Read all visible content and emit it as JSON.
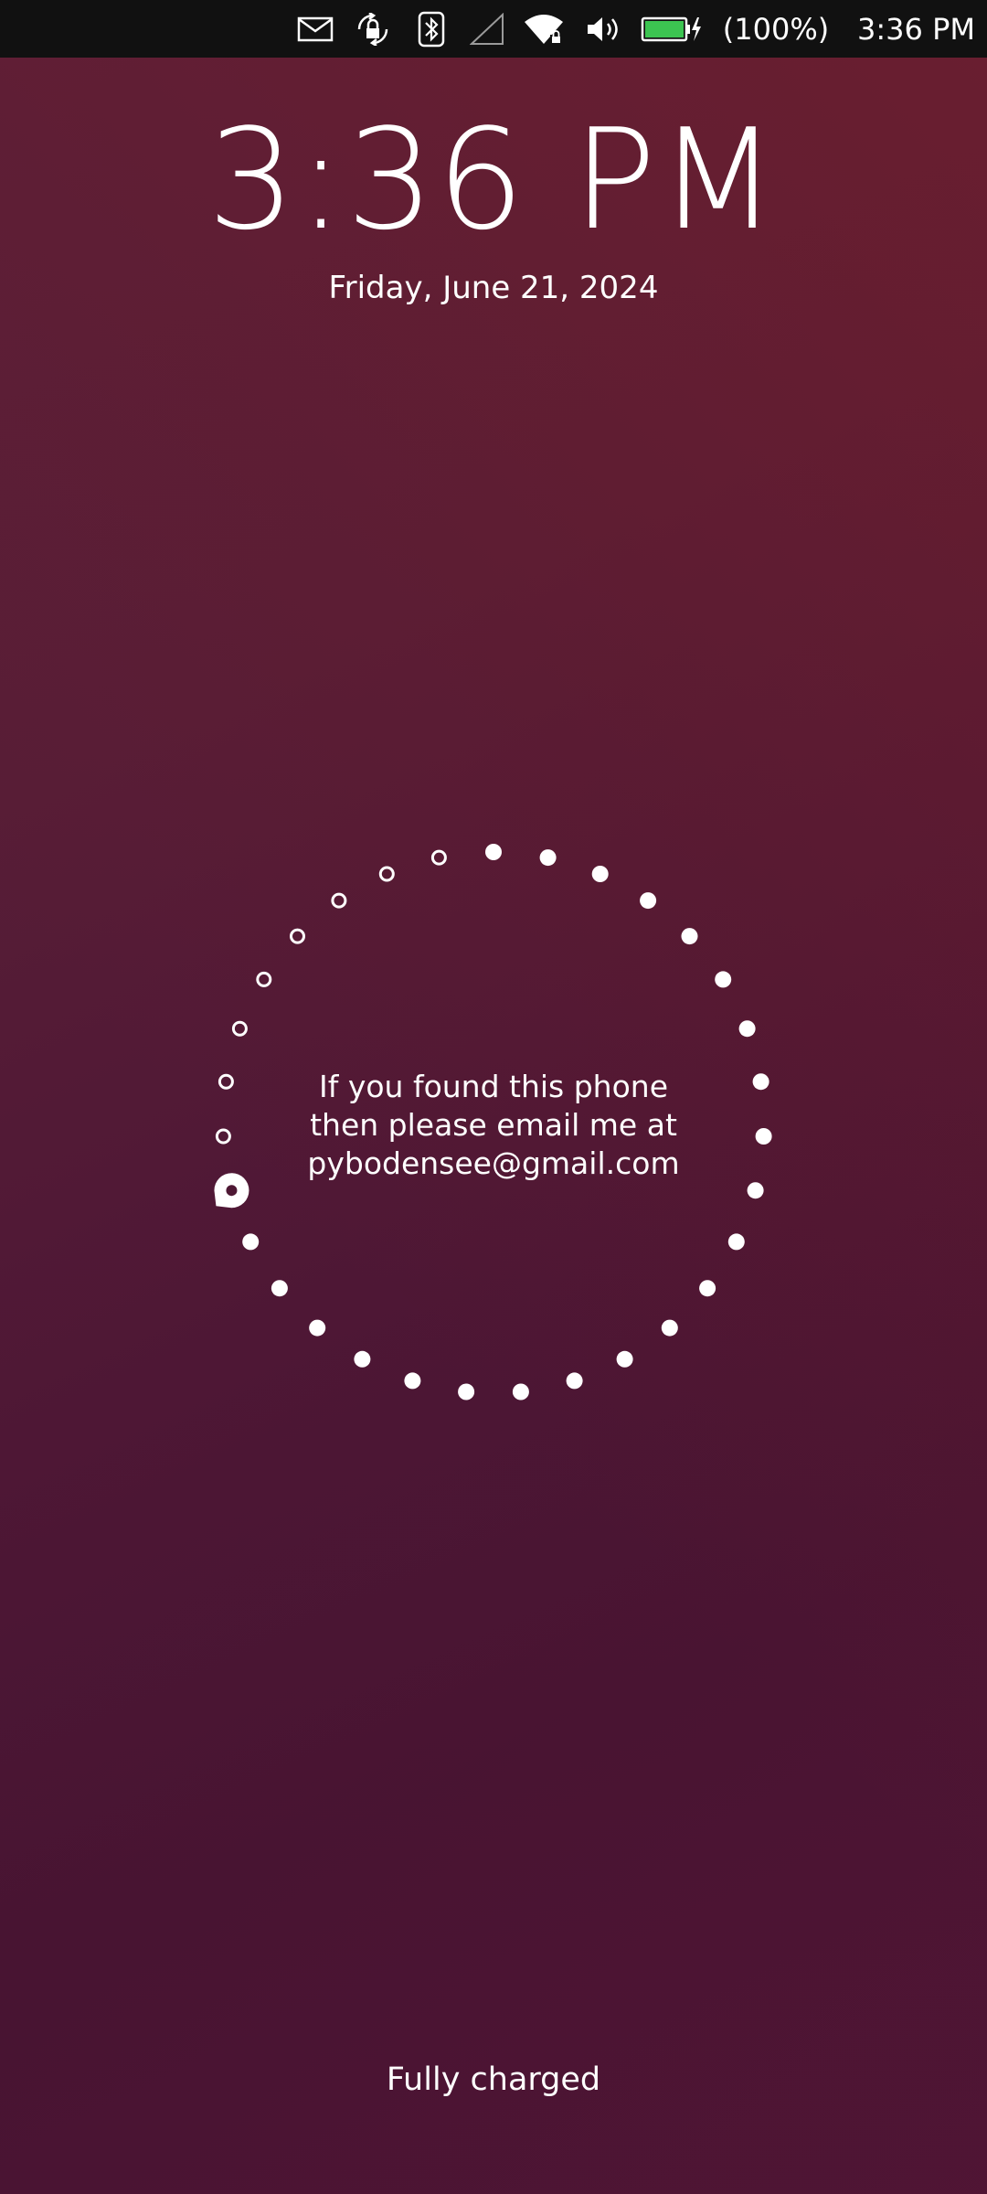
{
  "status_bar": {
    "icons": [
      "mail-icon",
      "rotation-lock-icon",
      "bluetooth-icon",
      "cellular-no-signal-icon",
      "wifi-locked-icon",
      "volume-icon",
      "battery-charging-icon"
    ],
    "battery_percent_text": "(100%)",
    "battery_level": 1.0,
    "time": "3:36 PM",
    "colors": {
      "background": "#111111",
      "battery_fill": "#3cc451"
    }
  },
  "lockscreen": {
    "clock": "3:36 PM",
    "date": "Friday, June 21, 2024",
    "message_lines": [
      "If you found this phone",
      "then please email me at",
      "pybodensee@gmail.com"
    ],
    "charge_status": "Fully charged",
    "infographic": {
      "dot_count": 31,
      "filled_dots": 23,
      "current_dot_index": 22
    }
  },
  "colors": {
    "accent": "#ffffff",
    "background_top_right": "#6a1e2c",
    "background_bottom_left": "#461432"
  }
}
